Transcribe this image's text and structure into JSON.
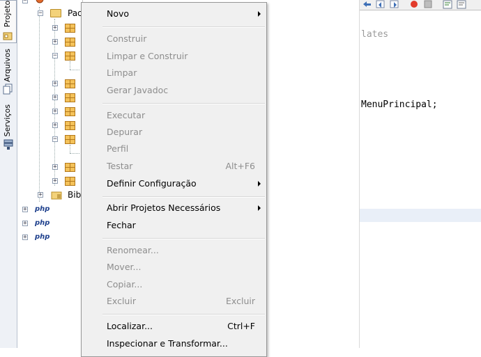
{
  "side_tabs": [
    {
      "label": "Projetos",
      "active": true
    },
    {
      "label": "Arquivos",
      "active": false
    },
    {
      "label": "Serviços",
      "active": false
    }
  ],
  "tree": {
    "package_folder_label": "Pac",
    "libraries_label": "Bibl",
    "php_label": "php"
  },
  "editor": {
    "lines": [
      {
        "text": "lates",
        "dim": true
      },
      {
        "text": "MenuPrincipal;",
        "dim": false
      }
    ]
  },
  "context_menu": {
    "items": [
      {
        "label": "Novo",
        "enabled": true,
        "submenu": true,
        "accel": ""
      },
      {
        "label": "Construir",
        "enabled": false,
        "submenu": false,
        "accel": ""
      },
      {
        "label": "Limpar e Construir",
        "enabled": false,
        "submenu": false,
        "accel": ""
      },
      {
        "label": "Limpar",
        "enabled": false,
        "submenu": false,
        "accel": ""
      },
      {
        "label": "Gerar Javadoc",
        "enabled": false,
        "submenu": false,
        "accel": ""
      },
      {
        "label": "Executar",
        "enabled": false,
        "submenu": false,
        "accel": ""
      },
      {
        "label": "Depurar",
        "enabled": false,
        "submenu": false,
        "accel": ""
      },
      {
        "label": "Perfil",
        "enabled": false,
        "submenu": false,
        "accel": ""
      },
      {
        "label": "Testar",
        "enabled": false,
        "submenu": false,
        "accel": "Alt+F6"
      },
      {
        "label": "Definir Configuração",
        "enabled": true,
        "submenu": true,
        "accel": ""
      },
      {
        "label": "Abrir Projetos Necessários",
        "enabled": true,
        "submenu": true,
        "accel": ""
      },
      {
        "label": "Fechar",
        "enabled": true,
        "submenu": false,
        "accel": ""
      },
      {
        "label": "Renomear...",
        "enabled": false,
        "submenu": false,
        "accel": ""
      },
      {
        "label": "Mover...",
        "enabled": false,
        "submenu": false,
        "accel": ""
      },
      {
        "label": "Copiar...",
        "enabled": false,
        "submenu": false,
        "accel": ""
      },
      {
        "label": "Excluir",
        "enabled": false,
        "submenu": false,
        "accel": "Excluir"
      },
      {
        "label": "Localizar...",
        "enabled": true,
        "submenu": false,
        "accel": "Ctrl+F"
      },
      {
        "label": "Inspecionar e Transformar...",
        "enabled": true,
        "submenu": false,
        "accel": ""
      }
    ]
  },
  "colors": {
    "menu_bg": "#f0f0f0",
    "disabled_text": "#8d8d8d",
    "package_icon": "#f4c25a"
  }
}
